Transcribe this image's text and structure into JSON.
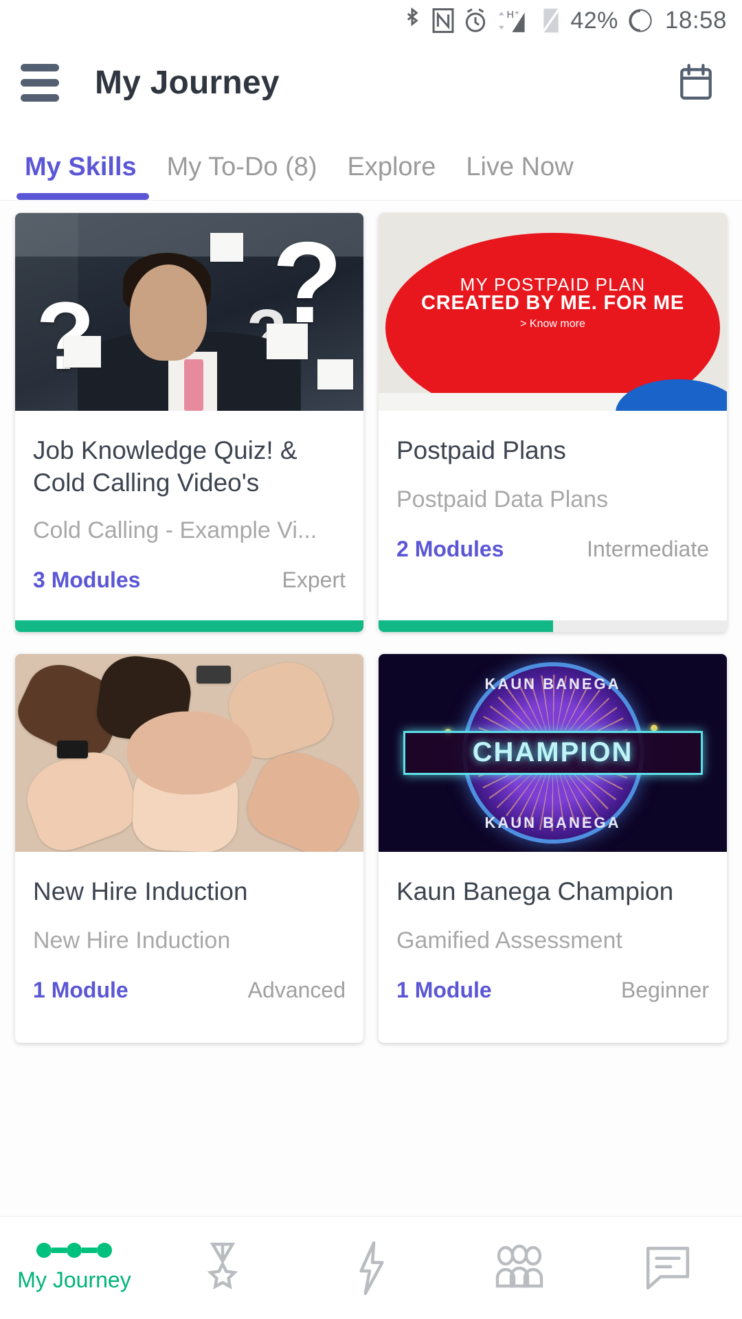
{
  "statusbar": {
    "icons": [
      "bluetooth-icon",
      "nfc-icon",
      "alarm-icon",
      "signal-hplus-icon",
      "sim-icon"
    ],
    "battery": "42%",
    "battery_icon": "battery-circle-icon",
    "time": "18:58"
  },
  "appbar": {
    "menu_icon": "hamburger-menu-icon",
    "title": "My Journey",
    "calendar_icon": "calendar-icon"
  },
  "tabs": [
    {
      "label": "My Skills",
      "active": true
    },
    {
      "label": "My To-Do (8)",
      "active": false
    },
    {
      "label": "Explore",
      "active": false
    },
    {
      "label": "Live Now",
      "active": false
    }
  ],
  "cards": [
    {
      "title": "Job Knowledge Quiz!  & Cold Calling Video's",
      "subtitle": "Cold Calling - Example Vi...",
      "modules": "3 Modules",
      "level": "Expert",
      "progress_percent": 100,
      "artwork": "quiz-thumbnail"
    },
    {
      "title": "Postpaid Plans",
      "subtitle": "Postpaid Data Plans",
      "modules": "2 Modules",
      "level": "Intermediate",
      "progress_percent": 50,
      "artwork": "postpaid-thumbnail",
      "art_text": {
        "line1": "MY POSTPAID PLAN",
        "line2": "CREATED BY ME. FOR ME",
        "line3": "> Know more"
      }
    },
    {
      "title": "New Hire Induction",
      "subtitle": "New Hire Induction",
      "modules": "1 Module",
      "level": "Advanced",
      "progress_percent": 0,
      "artwork": "teamwork-hands-thumbnail"
    },
    {
      "title": "Kaun Banega Champion",
      "subtitle": "Gamified Assessment",
      "modules": "1 Module",
      "level": "Beginner",
      "progress_percent": 0,
      "artwork": "kbc-thumbnail",
      "art_text": {
        "top": "KAUN BANEGA",
        "center": "CHAMPION",
        "bottom": "KAUN BANEGA"
      }
    }
  ],
  "bottomnav": [
    {
      "label": "My Journey",
      "icon": "journey-dots-icon",
      "active": true
    },
    {
      "label": "",
      "icon": "medal-icon",
      "active": false
    },
    {
      "label": "",
      "icon": "lightning-bolt-icon",
      "active": false
    },
    {
      "label": "",
      "icon": "people-group-icon",
      "active": false
    },
    {
      "label": "",
      "icon": "chat-message-icon",
      "active": false
    }
  ],
  "colors": {
    "accent_purple": "#5b56d6",
    "accent_green": "#00b377",
    "progress_green": "#12b886",
    "text_dark": "#3c4450",
    "text_muted": "#a8a8a8"
  }
}
